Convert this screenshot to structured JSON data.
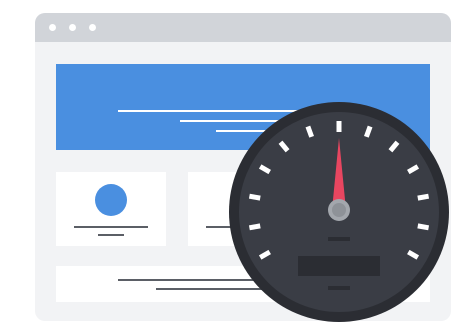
{
  "colors": {
    "browser_background": "#f2f3f5",
    "title_bar": "#d1d4d9",
    "hero_banner": "#4a8fe0",
    "card": "#ffffff",
    "text_line": "#5b5f66",
    "speedometer_body": "#3a3d45",
    "speedometer_rim": "#2b2d33",
    "needle": "#e84660",
    "needle_hub": "#a3a7ad"
  },
  "icons": {
    "window_controls": [
      "window-dot-icon",
      "window-dot-icon",
      "window-dot-icon"
    ],
    "card_image": "circle-avatar-icon",
    "speedometer": "speedometer-icon"
  },
  "speedometer": {
    "needle_level": 0.5,
    "tick_count": 13
  }
}
